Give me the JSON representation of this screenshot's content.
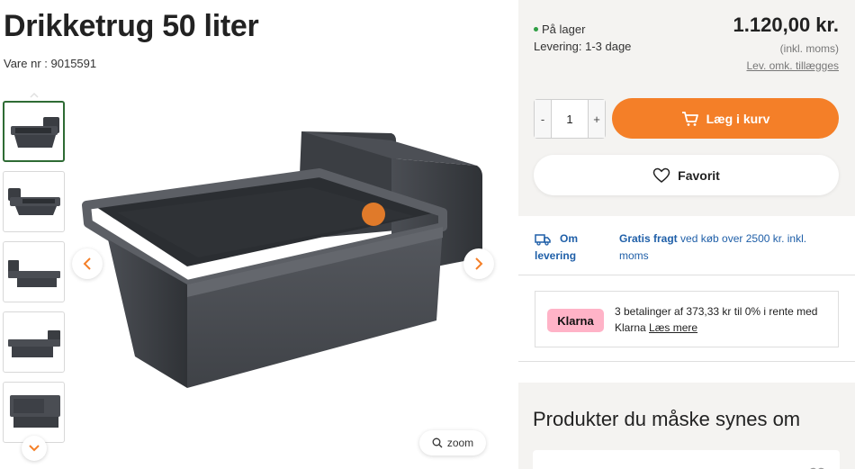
{
  "product": {
    "title": "Drikketrug 50 liter",
    "sku": "Vare nr : 9015591"
  },
  "gallery": {
    "thumbnail_count": 5,
    "active_index": 0,
    "zoom_label": "zoom"
  },
  "purchase": {
    "stock_status": "På lager",
    "delivery_time": "Levering: 1-3 dage",
    "price": "1.120,00 kr.",
    "vat_note": "(inkl. moms)",
    "shipping_cost_link": "Lev. omk. tillægges",
    "quantity": "1",
    "minus_label": "-",
    "plus_label": "+",
    "add_to_cart_label": "Læg i kurv",
    "favorite_label": "Favorit"
  },
  "shipping": {
    "link_line1": "Om",
    "link_line2": "levering",
    "free_bold": "Gratis fragt",
    "free_rest": " ved køb over 2500 kr. inkl. moms"
  },
  "klarna": {
    "logo_text": "Klarna",
    "text": "3 betalinger af 373,33 kr til 0% i rente med Klarna ",
    "link": "Læs mere"
  },
  "related": {
    "title": "Produkter du måske synes om"
  },
  "colors": {
    "accent_orange": "#f47f28",
    "link_blue": "#1f5fa8",
    "stock_green": "#2f9e44",
    "klarna_pink": "#ffb3c7",
    "active_thumb_border": "#2e6b34",
    "panel_bg": "#f4f3f1"
  },
  "icons": {
    "cart": "cart-icon",
    "heart": "heart-icon",
    "truck": "truck-icon",
    "zoom": "search-icon",
    "prev": "chevron-left-icon",
    "next": "chevron-right-icon",
    "up": "chevron-up-icon",
    "down": "chevron-down-icon"
  }
}
